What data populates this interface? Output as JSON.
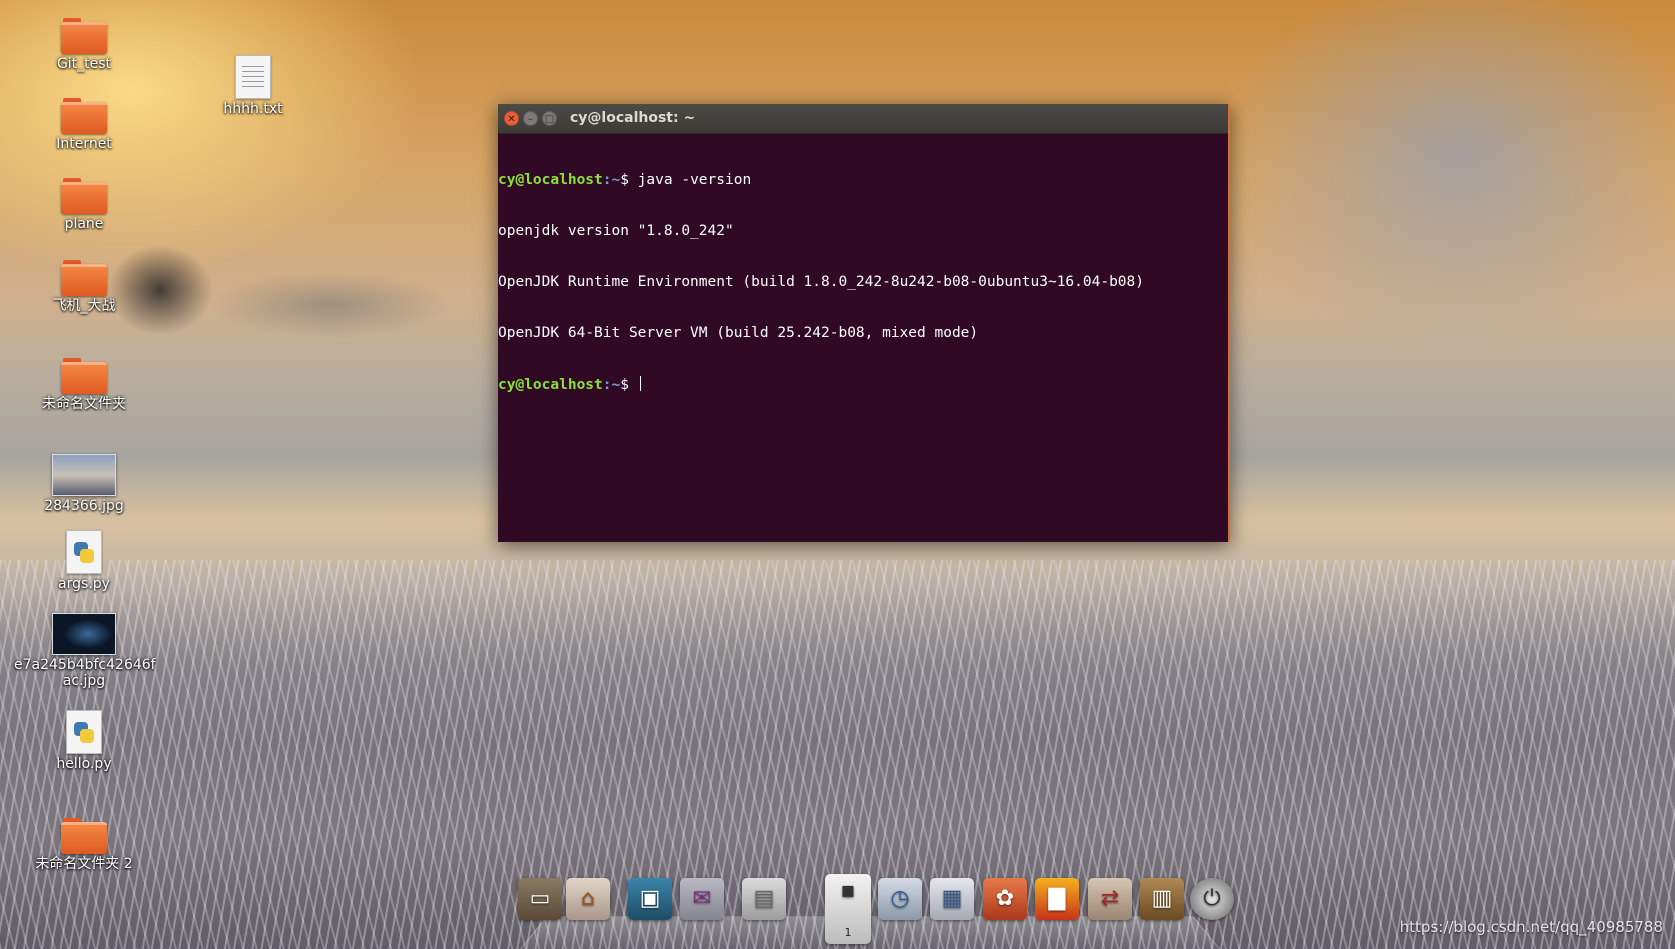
{
  "desktop": {
    "icons": [
      {
        "label": "Git_test",
        "kind": "folder"
      },
      {
        "label": "hhhh.txt",
        "kind": "text-file"
      },
      {
        "label": "Internet",
        "kind": "folder"
      },
      {
        "label": "plane",
        "kind": "folder"
      },
      {
        "label": "飞机_大战",
        "kind": "folder"
      },
      {
        "label": "未命名文件夹",
        "kind": "folder"
      },
      {
        "label": "284366.jpg",
        "kind": "image"
      },
      {
        "label": "args.py",
        "kind": "python-file"
      },
      {
        "label": "e7a245b4bfc42646f\nac.jpg",
        "kind": "image"
      },
      {
        "label": "hello.py",
        "kind": "python-file"
      },
      {
        "label": "未命名文件夹 2",
        "kind": "folder"
      }
    ]
  },
  "terminal": {
    "title": "cy@localhost: ~",
    "buttons": {
      "close": "✕",
      "minimize": "–",
      "maximize": "□"
    },
    "prompt_user": "cy@localhost",
    "prompt_path": ":~",
    "prompt_symbol": "$ ",
    "command": "java -version",
    "output": [
      "openjdk version \"1.8.0_242\"",
      "OpenJDK Runtime Environment (build 1.8.0_242-8u242-b08-0ubuntu3~16.04-b08)",
      "OpenJDK 64-Bit Server VM (build 25.242-b08, mixed mode)"
    ]
  },
  "dock": {
    "items": [
      {
        "name": "files-icon",
        "color": "#7a6a55"
      },
      {
        "name": "home-icon",
        "color": "#c9b9a6"
      },
      {
        "name": "image-viewer-icon",
        "color": "#2f6e8f"
      },
      {
        "name": "mail-icon",
        "color": "#9a9aa6"
      },
      {
        "name": "document-icon",
        "color": "#b5b5b5"
      },
      {
        "name": "workspace-switcher-icon",
        "color": "#d8d8d8"
      },
      {
        "name": "clock-search-icon",
        "color": "#aab4c2"
      },
      {
        "name": "system-monitor-icon",
        "color": "#c7c9cf"
      },
      {
        "name": "ubuntu-software-icon",
        "color": "#d2562c"
      },
      {
        "name": "graph-icon",
        "color": "#d84b1f"
      },
      {
        "name": "network-icon",
        "color": "#b8a58f"
      },
      {
        "name": "archive-icon",
        "color": "#8a6a3a"
      },
      {
        "name": "power-icon",
        "color": "#777777"
      }
    ],
    "workspace_number": "1"
  },
  "watermark": "https://blog.csdn.net/qq_40985788"
}
